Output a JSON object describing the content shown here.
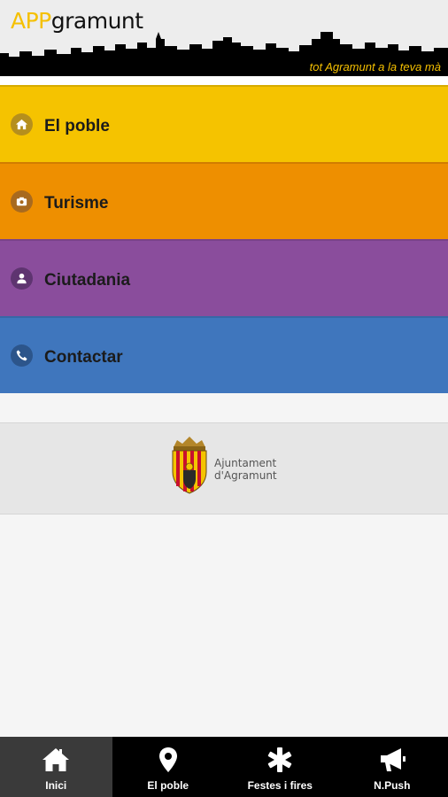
{
  "header": {
    "brand_part1": "APP",
    "brand_part2": "gramunt",
    "tagline": "tot Agramunt a la teva mà"
  },
  "menu": [
    {
      "label": "El poble",
      "icon": "home-icon",
      "color": "#f5c300",
      "icon_bg": "#b58f1d"
    },
    {
      "label": "Turisme",
      "icon": "camera-icon",
      "color": "#ee8f00",
      "icon_bg": "#a86a1f"
    },
    {
      "label": "Ciutadania",
      "icon": "person-icon",
      "color": "#8a4d9c",
      "icon_bg": "#5e3470"
    },
    {
      "label": "Contactar",
      "icon": "phone-icon",
      "color": "#3f76bd",
      "icon_bg": "#2c558b"
    }
  ],
  "logo": {
    "line1": "Ajuntament",
    "line2": "d'Agramunt"
  },
  "tabbar": [
    {
      "label": "Inici",
      "icon": "home-icon",
      "active": true
    },
    {
      "label": "El poble",
      "icon": "map-pin-icon",
      "active": false
    },
    {
      "label": "Festes i fires",
      "icon": "asterisk-icon",
      "active": false
    },
    {
      "label": "N.Push",
      "icon": "megaphone-icon",
      "active": false
    }
  ],
  "colors": {
    "accent_yellow": "#f5c000",
    "tabbar_bg": "#000000",
    "tabbar_active": "#3a3a3a"
  }
}
